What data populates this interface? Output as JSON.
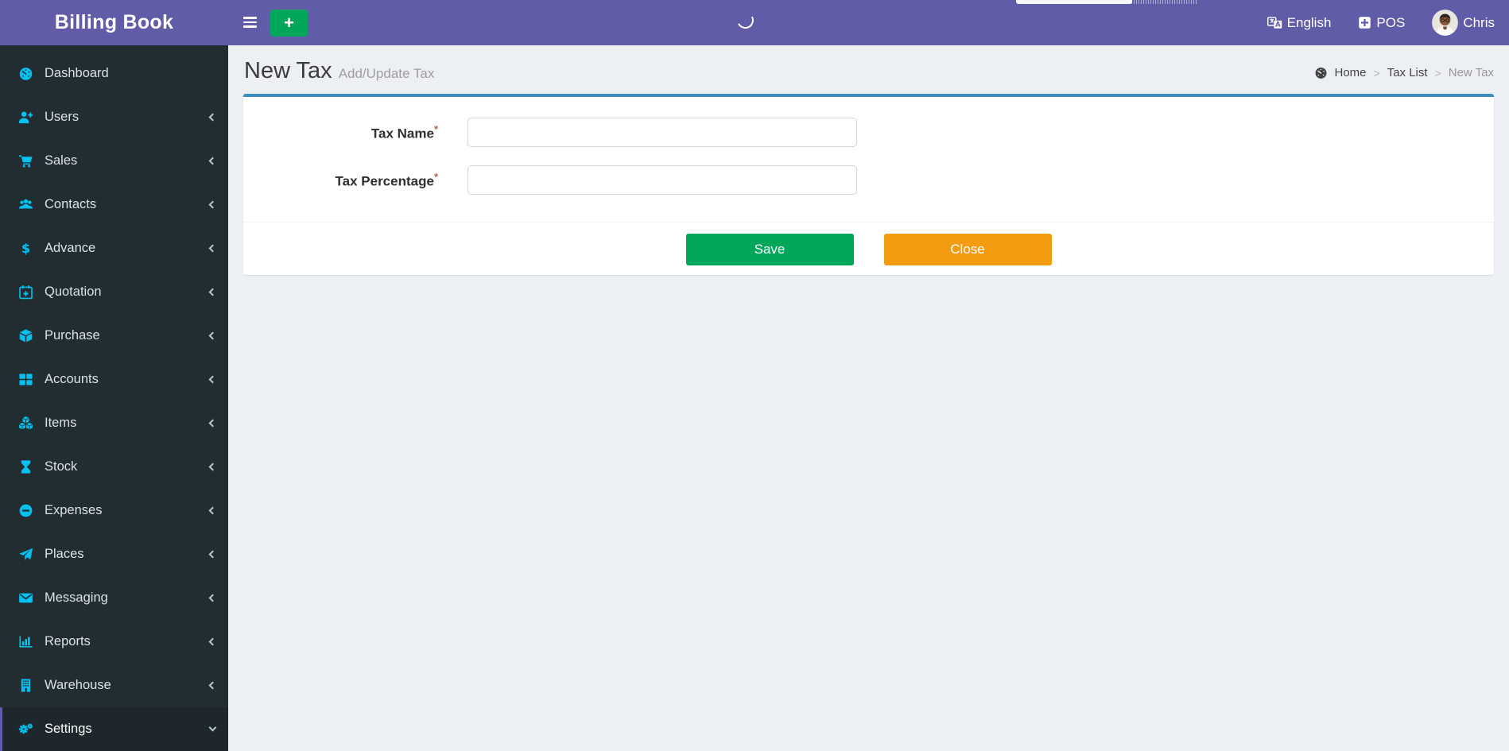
{
  "app": {
    "title": "Billing Book"
  },
  "topbar": {
    "language_label": "English",
    "pos_label": "POS",
    "user_name": "Chris",
    "quick_add_label": "+"
  },
  "page": {
    "title": "New Tax",
    "subtitle": "Add/Update Tax"
  },
  "breadcrumb": {
    "separator": ">",
    "items": [
      {
        "label": "Home",
        "icon": "dashboard-icon",
        "active": false
      },
      {
        "label": "Tax List",
        "active": false
      },
      {
        "label": "New Tax",
        "active": true
      }
    ]
  },
  "sidebar": {
    "items": [
      {
        "label": "Dashboard",
        "icon": "dashboard-icon",
        "chevron": null,
        "active": false
      },
      {
        "label": "Users",
        "icon": "user-plus-icon",
        "chevron": "left",
        "active": false
      },
      {
        "label": "Sales",
        "icon": "cart-icon",
        "chevron": "left",
        "active": false
      },
      {
        "label": "Contacts",
        "icon": "group-icon",
        "chevron": "left",
        "active": false
      },
      {
        "label": "Advance",
        "icon": "dollar-icon",
        "chevron": "left",
        "active": false
      },
      {
        "label": "Quotation",
        "icon": "calendar-plus-icon",
        "chevron": "left",
        "active": false
      },
      {
        "label": "Purchase",
        "icon": "cube-icon",
        "chevron": "left",
        "active": false
      },
      {
        "label": "Accounts",
        "icon": "grid-icon",
        "chevron": "left",
        "active": false
      },
      {
        "label": "Items",
        "icon": "cubes-icon",
        "chevron": "left",
        "active": false
      },
      {
        "label": "Stock",
        "icon": "hourglass-icon",
        "chevron": "left",
        "active": false
      },
      {
        "label": "Expenses",
        "icon": "minus-circle-icon",
        "chevron": "left",
        "active": false
      },
      {
        "label": "Places",
        "icon": "paper-plane-icon",
        "chevron": "left",
        "active": false
      },
      {
        "label": "Messaging",
        "icon": "envelope-icon",
        "chevron": "left",
        "active": false
      },
      {
        "label": "Reports",
        "icon": "bar-chart-icon",
        "chevron": "left",
        "active": false
      },
      {
        "label": "Warehouse",
        "icon": "building-icon",
        "chevron": "left",
        "active": false
      },
      {
        "label": "Settings",
        "icon": "gears-icon",
        "chevron": "down",
        "active": true
      }
    ]
  },
  "form": {
    "fields": [
      {
        "label": "Tax Name",
        "required": "*",
        "value": "",
        "placeholder": ""
      },
      {
        "label": "Tax Percentage",
        "required": "*",
        "value": "",
        "placeholder": ""
      }
    ],
    "save_label": "Save",
    "close_label": "Close"
  },
  "colors": {
    "navbar_purple": "#605ca8",
    "sidebar_dark": "#222d32",
    "sidebar_active_bg": "#1e282c",
    "icon_cyan": "#00c0ef",
    "box_accent_blue": "#3c8dbc",
    "save_green": "#00a65a",
    "close_orange": "#f39c12",
    "content_bg": "#ecf0f5"
  }
}
